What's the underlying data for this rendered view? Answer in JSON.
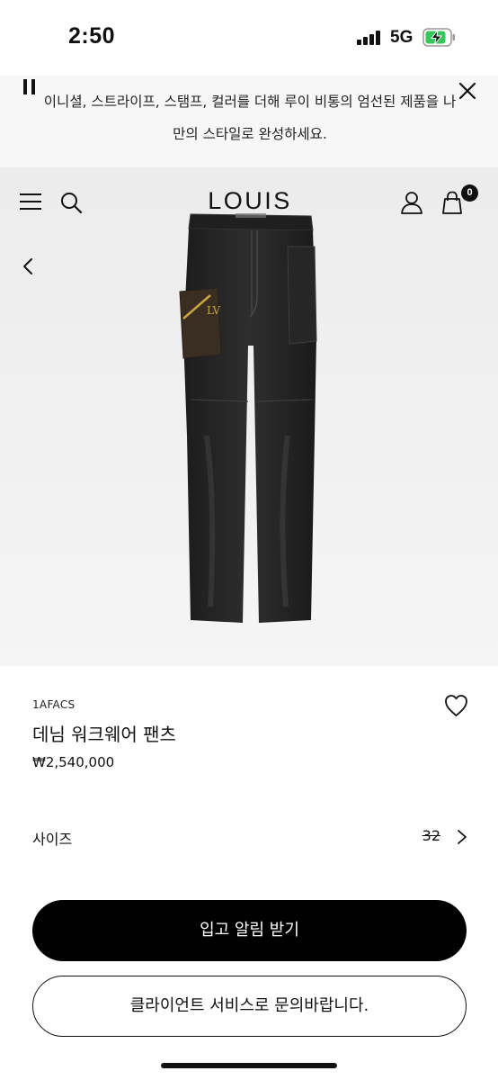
{
  "status_bar": {
    "time": "2:50",
    "network": "5G",
    "icons": [
      "signal-icon",
      "battery-charging-icon"
    ]
  },
  "promo": {
    "text": "이니셜, 스트라이프, 스탬프, 컬러를 더해 루이 비통의 엄선된 제품을 나만의 스타일로 완성하세요.",
    "icons": [
      "pause-icon",
      "close-icon"
    ]
  },
  "header": {
    "brand": "LOUIS VUITTON",
    "bag_count": "0",
    "icons": [
      "menu-icon",
      "search-icon",
      "account-icon",
      "shopping-bag-icon",
      "back-icon"
    ]
  },
  "product": {
    "sku": "1AFACS",
    "name": "데님 워크웨어 팬츠",
    "price": "₩2,540,000",
    "size_label": "사이즈",
    "size_value": "32",
    "image_icon": "product-image",
    "wishlist_icon": "heart-icon"
  },
  "actions": {
    "notify": "입고 알림 받기",
    "contact": "클라이언트 서비스로 문의바랍니다."
  },
  "colors": {
    "primary": "#000000",
    "banner_bg": "#f7f7f7",
    "hero_bg": "#efefef"
  }
}
